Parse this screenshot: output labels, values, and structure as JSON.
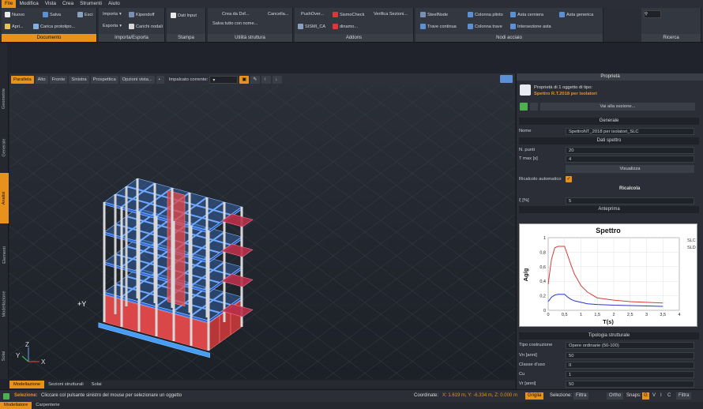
{
  "menu": [
    "File",
    "Modifica",
    "Vista",
    "Crea",
    "Strumenti",
    "Aiuto"
  ],
  "ribbon": {
    "documento": {
      "title": "Documento",
      "nuovo": "Nuovo",
      "apri": "Apri...",
      "salva": "Salva",
      "esci": "Esci",
      "carica": "Carica prototipo..."
    },
    "importa": {
      "title": "Importa/Esporta",
      "importa": "Importa",
      "esporta": "Esporta",
      "kipendoff": "Kipendoff",
      "carichi": "Carichi nodali"
    },
    "stampa": {
      "title": "Stampa",
      "dati": "Dati Input"
    },
    "utilita": {
      "title": "Utilità struttura",
      "crea": "Crea da Dxf...",
      "cancella": "Cancella...",
      "salva_nome": "Salva tutto con nome..."
    },
    "addons": {
      "title": "Addons",
      "push": "PushOver...",
      "sismocheck": "SismoCheck",
      "verifica": "Verifica Sezioni...",
      "sismica": "SISMI_CA",
      "dinamo": "dinamo..."
    },
    "nodi": {
      "title": "Nodi acciaio",
      "steelnode": "SteelNode",
      "colonna_plinto": "Colonna plinto",
      "asta_cerniera": "Asta cerniera",
      "asta_generica": "Asta generica",
      "trave_continua": "Trave continua",
      "colonna_trave": "Colonna trave",
      "intersezione": "Intersezione asta"
    },
    "ricerca": {
      "title": "Ricerca"
    }
  },
  "left_tabs": [
    "Geometrie",
    "Generale",
    "Analisi",
    "Elementi",
    "Modellazione",
    "Solai"
  ],
  "viewport_toolbar": {
    "views": [
      "Parallela",
      "Alto",
      "Fronte",
      "Sinistra",
      "Prospettica"
    ],
    "options": "Opzioni vista...",
    "impalcato_label": "Impalcato corrente:"
  },
  "axes": {
    "y": "+Y",
    "z": "Z",
    "yy": "Y",
    "x": "X"
  },
  "bottom_tabs": [
    "Modellazione",
    "Sezioni strutturali",
    "Solai"
  ],
  "status": {
    "label": "Selezione:",
    "message": "Cliccare col pulsante sinistro del mouse per selezionare un oggetto",
    "coords_label": "Coordinate:",
    "coords": "X: 1.619 m, Y: -6.334 m, Z: 0.000 m",
    "griglia": "Griglia",
    "selezione": "Selezione:",
    "filtra": "Filtra",
    "ortho": "Ortho",
    "snaps": "Snaps:",
    "snap_letters": [
      "G",
      "V",
      "I",
      "C"
    ],
    "filtra2": "Filtra"
  },
  "footer_tabs": [
    "Modellatore",
    "Carpenterie"
  ],
  "panel": {
    "title": "Proprietà",
    "header": "Proprietà di 1 oggetto di tipo:",
    "type": "Spettro R.T.2018 per isolatori",
    "vai": "Vai alla sezione...",
    "generale": "Generale",
    "nome_label": "Nome",
    "nome_value": "SpettroNT_2018 per isolatori_SLC",
    "dati": "Dati spettro",
    "npunti_label": "N. punti",
    "npunti_value": "20",
    "tmax_label": "T max [s]",
    "tmax_value": "4",
    "visualizza": "Visualizza",
    "ricalcolo_label": "Ricalcolo automatico",
    "ricalcola": "Ricalcola",
    "xi_label": "ξ [%]",
    "xi_value": "5",
    "anteprima": "Anteprima",
    "tipologia": "Tipologia strutturale",
    "tipo_label": "Tipo costruzione",
    "tipo_value": "Opere ordinarie (50-100)",
    "vn_label": "Vn [anni]",
    "vn_value": "50",
    "classe_label": "Classe d'uso",
    "classe_value": "II",
    "cu_label": "Cu",
    "cu_value": "1",
    "vr_label": "Vr [anni]",
    "vr_value": "50"
  },
  "colors": {
    "accent": "#e8921c",
    "slc": "#d83a3a",
    "sld": "#2636c8"
  },
  "chart_data": {
    "type": "line",
    "title": "Spettro",
    "xlabel": "T(s)",
    "ylabel": "Ag/g",
    "xlim": [
      0,
      4
    ],
    "ylim": [
      0,
      1
    ],
    "xticks": [
      "0",
      "0,5",
      "1",
      "1,5",
      "2",
      "2,5",
      "3",
      "3,5",
      "4"
    ],
    "yticks": [
      "0",
      "0,2",
      "0,4",
      "0,6",
      "0,8",
      "1"
    ],
    "grid": true,
    "legend": "right",
    "series": [
      {
        "name": "SLC",
        "x": [
          0,
          0.1,
          0.2,
          0.3,
          0.5,
          0.6,
          0.7,
          0.8,
          1.0,
          1.2,
          1.5,
          2.0,
          2.5,
          3.0,
          3.5
        ],
        "y": [
          0.36,
          0.7,
          0.86,
          0.88,
          0.88,
          0.75,
          0.62,
          0.5,
          0.34,
          0.25,
          0.17,
          0.14,
          0.12,
          0.11,
          0.1
        ]
      },
      {
        "name": "SLD",
        "x": [
          0,
          0.1,
          0.2,
          0.3,
          0.5,
          0.6,
          0.7,
          0.8,
          1.0,
          1.2,
          1.5,
          2.0,
          2.5,
          3.0,
          3.5
        ],
        "y": [
          0.12,
          0.18,
          0.21,
          0.22,
          0.22,
          0.18,
          0.15,
          0.13,
          0.11,
          0.09,
          0.08,
          0.07,
          0.065,
          0.06,
          0.055
        ]
      }
    ]
  }
}
